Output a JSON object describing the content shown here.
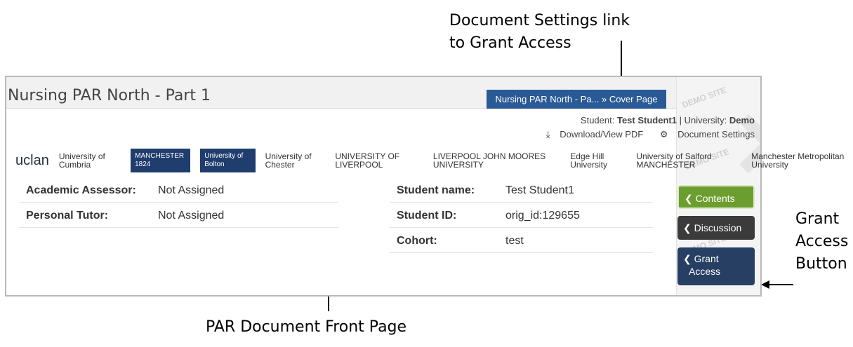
{
  "annotations": {
    "settings_line1": "Document Settings link",
    "settings_line2": "to Grant Access",
    "grant_line1": "Grant",
    "grant_line2": "Access",
    "grant_line3": "Button",
    "front_page": "PAR Document Front Page"
  },
  "header": {
    "title": "Nursing PAR North - Part 1",
    "breadcrumb": "Nursing PAR North - Pa... » Cover Page"
  },
  "student_info": {
    "student_label": "Student: ",
    "student_name": "Test Student1",
    "separator": " | ",
    "university_label": "University: ",
    "university": "Demo"
  },
  "links": {
    "download": "Download/View PDF",
    "settings": "Document Settings"
  },
  "logos": [
    "uclan",
    "University of Cumbria",
    "MANCHESTER 1824",
    "University of Bolton",
    "University of Chester",
    "UNIVERSITY OF LIVERPOOL",
    "LIVERPOOL JOHN MOORES UNIVERSITY",
    "Edge Hill University",
    "University of Salford MANCHESTER",
    "Manchester Metropolitan University"
  ],
  "left_fields": [
    {
      "label": "Academic Assessor:",
      "value": "Not Assigned"
    },
    {
      "label": "Personal Tutor:",
      "value": "Not Assigned"
    }
  ],
  "right_fields": [
    {
      "label": "Student name:",
      "value": "Test Student1"
    },
    {
      "label": "Student ID:",
      "value": "orig_id:129655"
    },
    {
      "label": "Cohort:",
      "value": "test"
    }
  ],
  "sidebar": {
    "contents": "Contents",
    "discussion": "Discussion",
    "grant_line1": "Grant",
    "grant_line2": "Access",
    "watermark": "DEMO SITE"
  },
  "colors": {
    "breadcrumb": "#2a5a96",
    "contents": "#6c9e2f",
    "discussion": "#3b3b3b",
    "grant": "#263f63"
  }
}
